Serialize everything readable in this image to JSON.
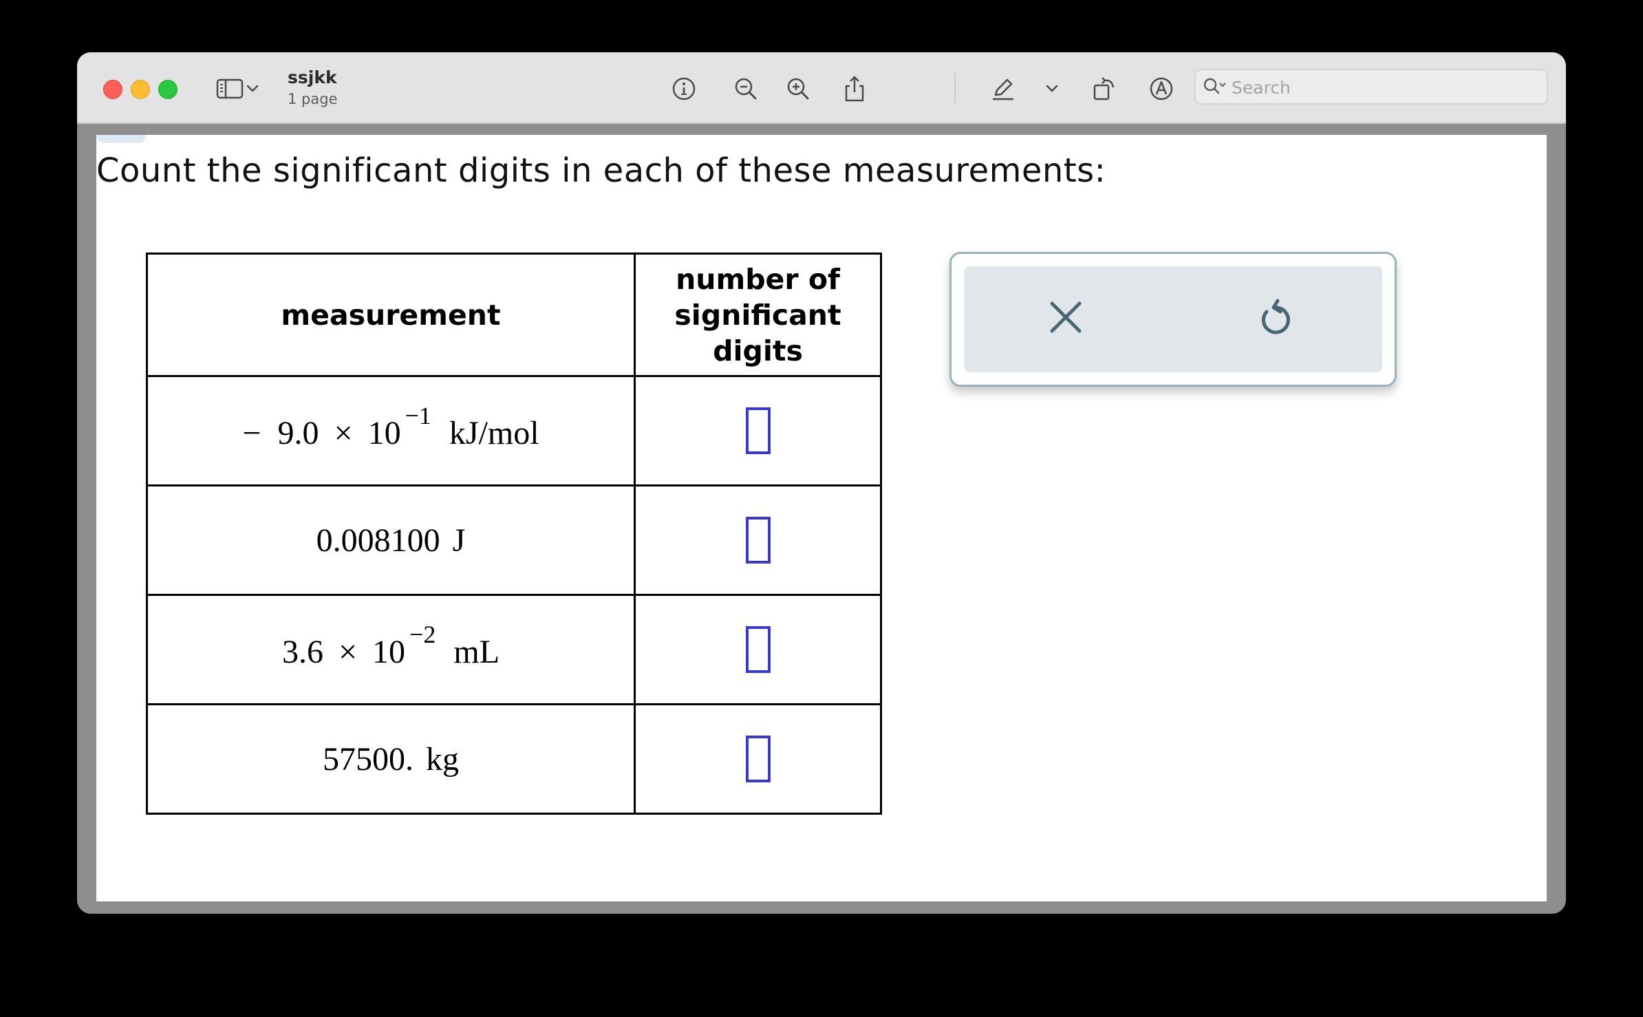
{
  "window": {
    "doc_title": "ssjkk",
    "doc_subtitle": "1 page",
    "search_placeholder": "Search",
    "toolbar_icons": [
      "sidebar-icon",
      "chevron-down-icon",
      "info-icon",
      "zoom-out-icon",
      "zoom-in-icon",
      "share-icon",
      "markup-pen-icon",
      "chevron-down-icon",
      "rotate-icon",
      "annotate-icon",
      "signature-icon",
      "search-icon"
    ]
  },
  "content": {
    "question": "Count the significant digits in each of these measurements:",
    "table": {
      "headers": [
        "measurement",
        "number of significant digits"
      ],
      "rows": [
        {
          "sign": "−",
          "mantissa": "9.0",
          "times": "×",
          "base": "10",
          "exponent": "−1",
          "plain": "",
          "unit": "kJ/mol",
          "answer": ""
        },
        {
          "sign": "",
          "mantissa": "",
          "times": "",
          "base": "",
          "exponent": "",
          "plain": "0.008100",
          "unit": "J",
          "answer": ""
        },
        {
          "sign": "",
          "mantissa": "3.6",
          "times": "×",
          "base": "10",
          "exponent": "−2",
          "plain": "",
          "unit": "mL",
          "answer": ""
        },
        {
          "sign": "",
          "mantissa": "",
          "times": "",
          "base": "",
          "exponent": "",
          "plain": "57500.",
          "unit": "kg",
          "answer": ""
        }
      ]
    },
    "tools": {
      "clear_icon": "x-icon",
      "undo_icon": "undo-icon"
    }
  },
  "colors": {
    "answer_box_border": "#3a37d6",
    "tool_panel_border": "#9bb2bd",
    "tool_panel_fill": "#e0e6e9",
    "tool_icon": "#4a6672"
  }
}
